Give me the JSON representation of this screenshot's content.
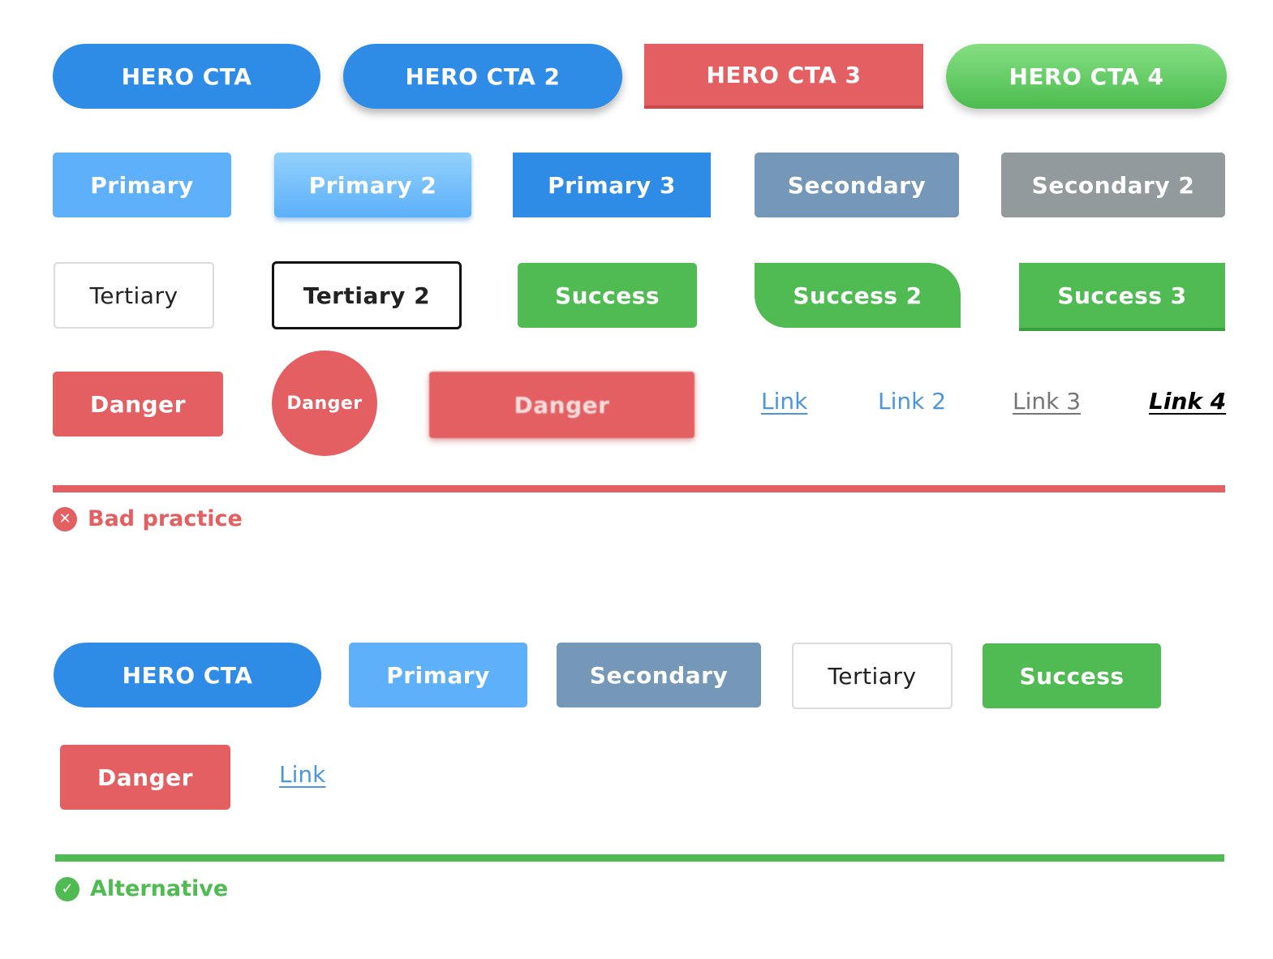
{
  "colors": {
    "blue": "#2e8be6",
    "light_blue": "#5eb0fa",
    "slate": "#7597b8",
    "gray": "#939a9b",
    "green": "#4fbb52",
    "red": "#e35f61"
  },
  "bad_practice": {
    "hero": [
      "HERO CTA",
      "HERO CTA 2",
      "HERO CTA 3",
      "HERO CTA 4"
    ],
    "primary": [
      "Primary",
      "Primary 2",
      "Primary 3"
    ],
    "secondary": [
      "Secondary",
      "Secondary 2"
    ],
    "tertiary": [
      "Tertiary",
      "Tertiary 2"
    ],
    "success": [
      "Success",
      "Success 2",
      "Success 3"
    ],
    "danger": [
      "Danger",
      "Danger",
      "Danger"
    ],
    "links": [
      "Link",
      "Link 2",
      "Link 3",
      "Link 4"
    ],
    "label": "Bad practice",
    "icon": "x-circle-icon"
  },
  "alternative": {
    "hero": "HERO CTA",
    "primary": "Primary",
    "secondary": "Secondary",
    "tertiary": "Tertiary",
    "success": "Success",
    "danger": "Danger",
    "link": "Link",
    "label": "Alternative",
    "icon": "check-circle-icon"
  }
}
